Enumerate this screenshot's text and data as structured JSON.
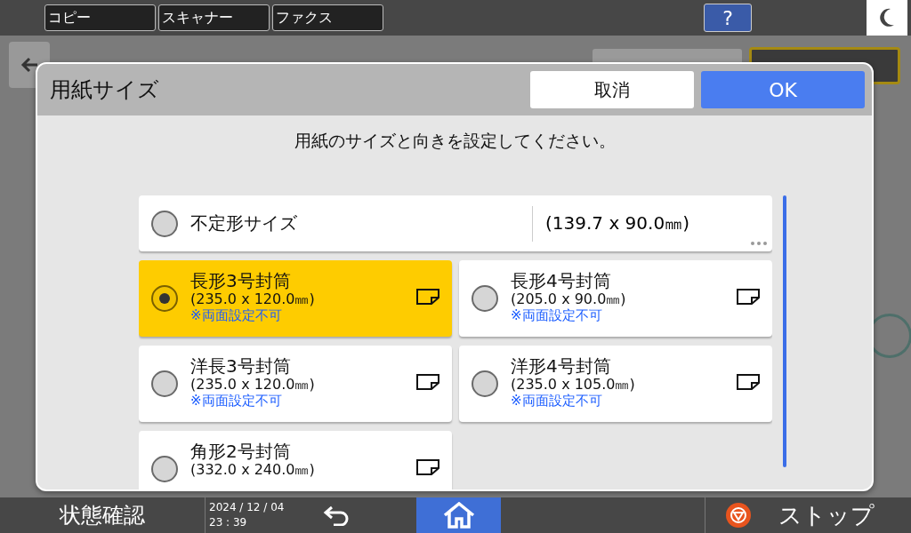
{
  "top_bar": {
    "tabs": [
      {
        "label": "コピー"
      },
      {
        "label": "スキャナー"
      },
      {
        "label": "ファクス"
      }
    ],
    "help": "?"
  },
  "dialog": {
    "title": "用紙サイズ",
    "cancel": "取消",
    "ok": "OK",
    "instruction": "用紙のサイズと向きを設定してください。",
    "sizes": [
      {
        "kind": "custom",
        "name": "不定形サイズ",
        "dimensions": "(139.7 x 90.0㎜)",
        "selected": false
      },
      {
        "kind": "envelope",
        "name": "長形3号封筒",
        "dimensions": "(235.0 x 120.0㎜)",
        "note": "※両面設定不可",
        "selected": true
      },
      {
        "kind": "envelope",
        "name": "長形4号封筒",
        "dimensions": "(205.0 x 90.0㎜)",
        "note": "※両面設定不可",
        "selected": false
      },
      {
        "kind": "envelope",
        "name": "洋長3号封筒",
        "dimensions": "(235.0 x 120.0㎜)",
        "note": "※両面設定不可",
        "selected": false
      },
      {
        "kind": "envelope",
        "name": "洋形4号封筒",
        "dimensions": "(235.0 x 105.0㎜)",
        "note": "※両面設定不可",
        "selected": false
      },
      {
        "kind": "envelope",
        "name": "角形2号封筒",
        "dimensions": "(332.0 x 240.0㎜)",
        "selected": false
      }
    ]
  },
  "bottom_bar": {
    "status": "状態確認",
    "date": "2024 / 12 / 04",
    "time": "23 : 39",
    "stop": "ストップ"
  }
}
